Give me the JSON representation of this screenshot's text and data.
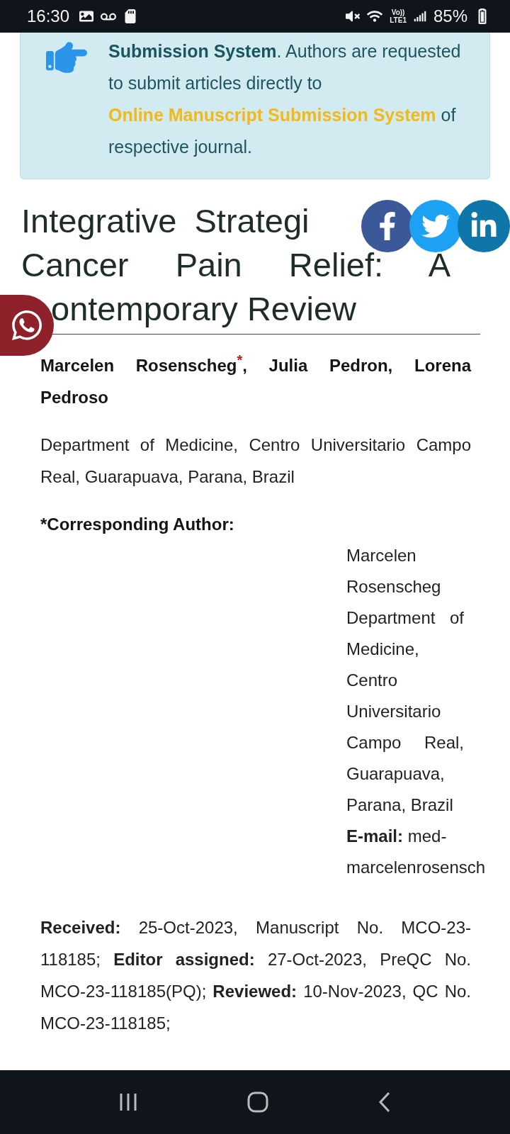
{
  "status_bar": {
    "time": "16:30",
    "network_top": "Vo))",
    "network_bottom": "LTE1",
    "battery": "85%"
  },
  "notice": {
    "text": "**Submission System**. Authors are requested to submit articles directly to",
    "link": "Online Manuscript Submission System",
    "text_after": "of respective journal."
  },
  "article": {
    "title_lines": [
      "Integrative Strategi",
      "Cancer Pain Relief: A",
      "ontemporary Review"
    ],
    "authors": "Marcelen Rosenscheg$^{*}$, Julia Pedron, Lorena Pedroso",
    "affiliation": "Department of Medicine, Centro Universitario Campo Real, Guarapuava, Parana, Brazil",
    "corresponding_heading": "*Corresponding Author:",
    "corresponding_address": "Marcelen Rosenscheg Department of Medicine, Centro Universitario Campo Real, Guarapuava, Parana, Brazil",
    "email_label": "E-mail:",
    "email": "med-marcelenrosensch",
    "history": "**Received:** 25-Oct-2023, Manuscript No. MCO-23-118185; **Editor assigned:** 27-Oct-2023, PreQC No. MCO-23-118185(PQ); **Reviewed:** 10-Nov-2023, QC No. MCO-23-118185;"
  }
}
